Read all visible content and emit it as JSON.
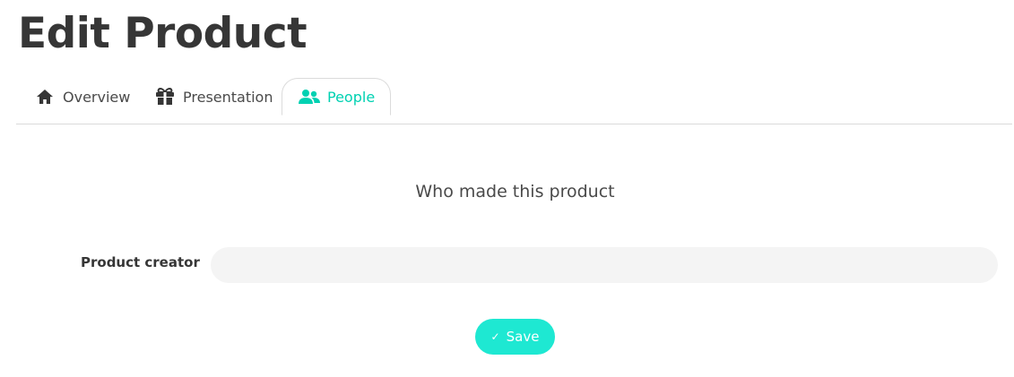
{
  "page": {
    "title": "Edit Product"
  },
  "tabs": [
    {
      "label": "Overview",
      "icon": "home-icon",
      "active": false
    },
    {
      "label": "Presentation",
      "icon": "gift-icon",
      "active": false
    },
    {
      "label": "People",
      "icon": "users-icon",
      "active": true
    }
  ],
  "form": {
    "heading": "Who made this product",
    "creator_label": "Product creator",
    "creator_value": "",
    "creator_placeholder": "",
    "save_label": "Save",
    "save_icon": "check-icon"
  },
  "colors": {
    "accent": "#00d1b2",
    "save_button": "#1ee8d2",
    "input_background": "#f4f4f4",
    "text": "#363636",
    "border": "#dbdbdb"
  }
}
